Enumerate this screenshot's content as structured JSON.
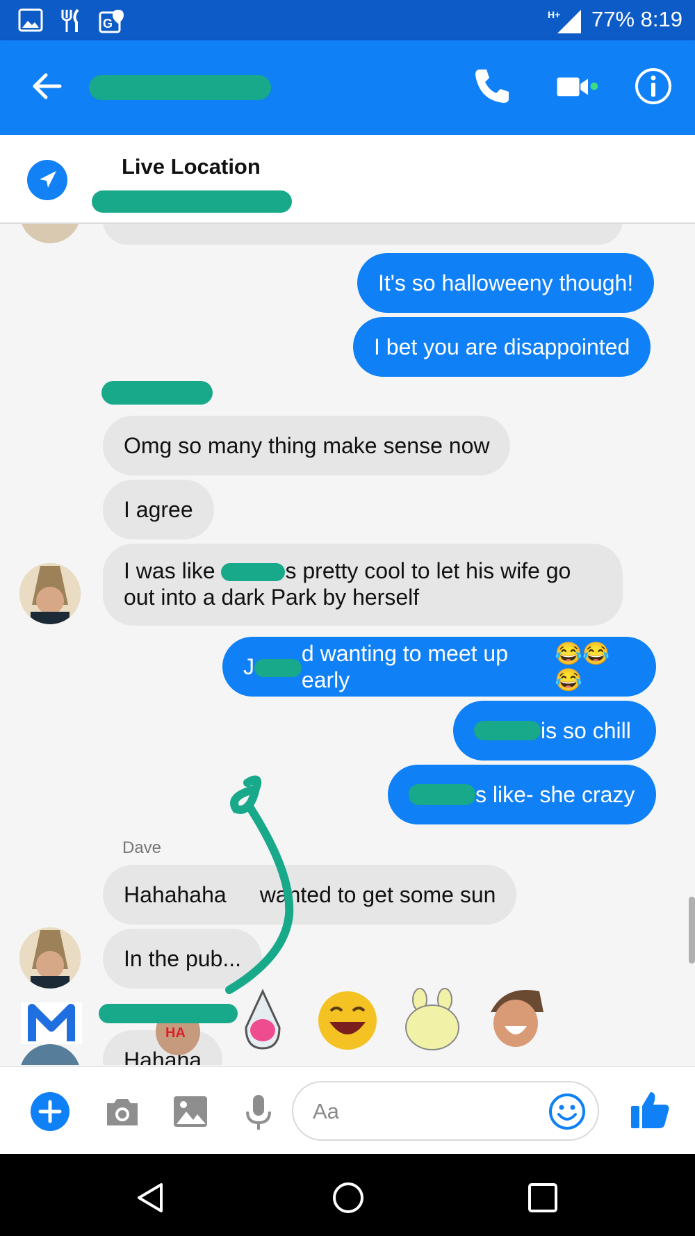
{
  "status_bar": {
    "network": "H+",
    "battery": "77%",
    "time": "8:19"
  },
  "header": {
    "back_icon": "arrow-left-icon",
    "call_icon": "phone-icon",
    "video_icon": "video-camera-icon",
    "info_icon": "info-icon",
    "online_color": "#3ddc84"
  },
  "live_location": {
    "title": "Live Location",
    "icon": "navigation-arrow-icon"
  },
  "messages": {
    "m1": "It's so halloweeny though!",
    "m2": "I bet you are disappointed",
    "m3": "Omg so many thing make sense now",
    "m4": "I agree",
    "m5_a": "I was like ",
    "m5_b": "s pretty cool to let his wife go",
    "m5_c": "out into a dark Park by herself",
    "m6_a": "J",
    "m6_b": "d wanting to meet up early",
    "m6_emoji": "😂😂😂",
    "m7": " is so chill",
    "m8": "s like- she crazy",
    "sender": "Dave",
    "m9_a": "Hahahaha",
    "m9_b": " wanted to get some sun",
    "m10": "In the pub...",
    "m11": "Hahaha"
  },
  "stickers": [
    "laughing-pig-sticker",
    "laughing-shark-sticker",
    "laughing-emoji-sticker",
    "laughing-bunny-sticker",
    "laughing-warrior-sticker"
  ],
  "composer": {
    "placeholder": "Aa",
    "plus_icon": "plus-icon",
    "camera_icon": "camera-icon",
    "gallery_icon": "image-icon",
    "mic_icon": "microphone-icon",
    "emoji_icon": "smiley-icon",
    "like_icon": "thumbs-up-icon"
  },
  "colors": {
    "brand_blue": "#0f80f5",
    "status_blue": "#0d5bc7",
    "incoming_bubble": "#e6e6e6",
    "redaction": "#18a88a"
  }
}
